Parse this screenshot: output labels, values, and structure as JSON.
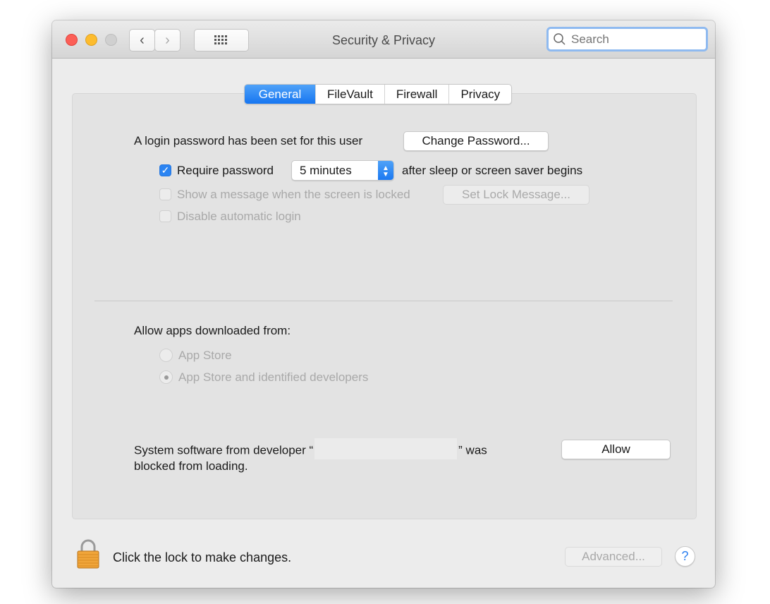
{
  "window": {
    "title": "Security & Privacy"
  },
  "search": {
    "placeholder": "Search"
  },
  "tabs": [
    "General",
    "FileVault",
    "Firewall",
    "Privacy"
  ],
  "general": {
    "login_text": "A login password has been set for this user",
    "change_password": "Change Password...",
    "require_password_label": "Require password",
    "require_password_checked": true,
    "require_password_interval": "5 minutes",
    "after_sleep_text": "after sleep or screen saver begins",
    "show_message_label": "Show a message when the screen is locked",
    "set_lock_message": "Set Lock Message...",
    "disable_auto_login_label": "Disable automatic login"
  },
  "downloads": {
    "heading": "Allow apps downloaded from:",
    "options": [
      "App Store",
      "App Store and identified developers"
    ],
    "selected": "App Store and identified developers"
  },
  "blocked": {
    "text_before": "System software from developer “",
    "text_after": "” was",
    "text_line2": "blocked from loading.",
    "allow": "Allow"
  },
  "footer": {
    "lock_text": "Click the lock to make changes.",
    "advanced": "Advanced...",
    "help": "?"
  }
}
